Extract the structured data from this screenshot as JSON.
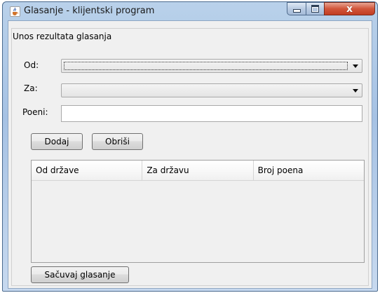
{
  "window": {
    "title": "Glasanje - klijentski program",
    "controls": {
      "close_symbol": "x"
    }
  },
  "form": {
    "group_title": "Unos rezultata glasanja",
    "od_label": "Od:",
    "za_label": "Za:",
    "poeni_label": "Poeni:",
    "od_value": "",
    "za_value": "",
    "poeni_value": "",
    "add_button": "Dodaj",
    "delete_button": "Obriši",
    "save_button": "Sačuvaj glasanje"
  },
  "table": {
    "columns": [
      "Od države",
      "Za državu",
      "Broj poena"
    ],
    "rows": []
  },
  "icons": {
    "app": "java-cup-icon",
    "minimize": "minimize-icon",
    "maximize": "maximize-icon",
    "close": "close-icon",
    "dropdown": "chevron-down-icon"
  },
  "colors": {
    "titlebar": "#b9d1ea",
    "close_button": "#c94a30",
    "client_bg": "#f0f0f0"
  }
}
